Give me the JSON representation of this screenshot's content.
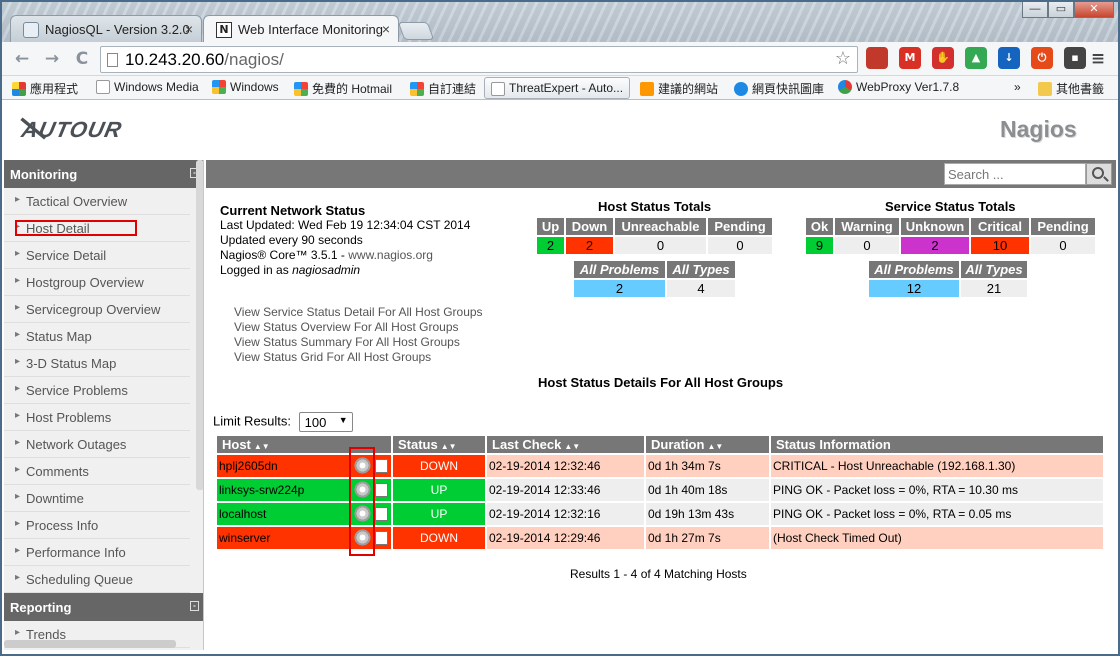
{
  "browser": {
    "tabs": [
      {
        "label": "NagiosQL - Version 3.2.0",
        "icon": "nagiosql-icon",
        "active": false
      },
      {
        "label": "Web Interface Monitoring",
        "icon": "n-icon",
        "icon_glyph": "N",
        "active": true
      }
    ],
    "tab_close": "×",
    "window_buttons": {
      "minimize": "—",
      "maximize": "▭",
      "close": "✕"
    },
    "url_host": "10.243.20.60",
    "url_path": "/nagios/",
    "nav": {
      "back": "←",
      "forward": "→",
      "reload": "C"
    },
    "bookmarks": [
      "應用程式",
      "Windows Media",
      "Windows",
      "免費的 Hotmail",
      "自訂連結",
      "ThreatExpert - Auto...",
      "建議的網站",
      "網頁快訊圖庫",
      "WebProxy Ver1.7.8",
      "»",
      "其他書籤"
    ],
    "extensions": [
      {
        "name": "bookmark-ext-icon",
        "color": "#c0392b",
        "glyph": ""
      },
      {
        "name": "gmail-ext-icon",
        "color": "#d93025",
        "glyph": "M"
      },
      {
        "name": "adblock-ext-icon",
        "color": "#d32f2f",
        "glyph": "✋"
      },
      {
        "name": "drive-ext-icon",
        "color": "#34a853",
        "glyph": "▲"
      },
      {
        "name": "download-ext-icon",
        "color": "#1565c0",
        "glyph": "↓"
      },
      {
        "name": "power-ext-icon",
        "color": "#e64a19",
        "glyph": "⏻"
      },
      {
        "name": "gamepad-ext-icon",
        "color": "#444444",
        "glyph": "▪"
      }
    ],
    "menu_glyph": "≡",
    "star_glyph": "☆"
  },
  "header": {
    "left_logo": "AUTOUR",
    "right_logo": "Nagios"
  },
  "menu": {
    "monitoring_title": "Monitoring",
    "collapse_glyph": "-",
    "monitoring_items": [
      "Tactical Overview",
      "Host Detail",
      "Service Detail",
      "Hostgroup Overview",
      "Servicegroup Overview",
      "Status Map",
      "3-D Status Map",
      "Service Problems",
      "Host Problems",
      "Network Outages",
      "Comments",
      "Downtime",
      "Process Info",
      "Performance Info",
      "Scheduling Queue"
    ],
    "reporting_title": "Reporting",
    "reporting_items": [
      "Trends"
    ]
  },
  "search": {
    "placeholder": "Search ..."
  },
  "status": {
    "title": "Current Network Status",
    "last_updated": "Last Updated: Wed Feb 19 12:34:04 CST 2014",
    "update_interval": "Updated every 90 seconds",
    "core_version": "Nagios® Core™ 3.5.1 - ",
    "core_link": "www.nagios.org",
    "logged_in_prefix": "Logged in as ",
    "user": "nagiosadmin"
  },
  "host_totals": {
    "title": "Host Status Totals",
    "headers": [
      "Up",
      "Down",
      "Unreachable",
      "Pending"
    ],
    "values": [
      "2",
      "2",
      "0",
      "0"
    ],
    "problem_headers": [
      "All Problems",
      "All Types"
    ],
    "problem_values": [
      "2",
      "4"
    ]
  },
  "service_totals": {
    "title": "Service Status Totals",
    "headers": [
      "Ok",
      "Warning",
      "Unknown",
      "Critical",
      "Pending"
    ],
    "values": [
      "9",
      "0",
      "2",
      "10",
      "0"
    ],
    "problem_headers": [
      "All Problems",
      "All Types"
    ],
    "problem_values": [
      "12",
      "21"
    ]
  },
  "view_links": [
    "View Service Status Detail For All Host Groups",
    "View Status Overview For All Host Groups",
    "View Status Summary For All Host Groups",
    "View Status Grid For All Host Groups"
  ],
  "details": {
    "title": "Host Status Details For All Host Groups",
    "limit_label": "Limit Results:",
    "limit_value": "100",
    "sort_glyph": "▲▼",
    "columns": [
      "Host",
      "Status",
      "Last Check",
      "Duration",
      "Status Information"
    ],
    "rows": [
      {
        "host": "hplj2605dn",
        "status": "DOWN",
        "last_check": "02-19-2014 12:32:46",
        "duration": "0d 1h 34m 7s",
        "info": "CRITICAL - Host Unreachable (192.168.1.30)"
      },
      {
        "host": "linksys-srw224p",
        "status": "UP",
        "last_check": "02-19-2014 12:33:46",
        "duration": "0d 1h 40m 18s",
        "info": "PING OK - Packet loss = 0%, RTA = 10.30 ms"
      },
      {
        "host": "localhost",
        "status": "UP",
        "last_check": "02-19-2014 12:32:16",
        "duration": "0d 19h 13m 43s",
        "info": "PING OK - Packet loss = 0%, RTA = 0.05 ms"
      },
      {
        "host": "winserver",
        "status": "DOWN",
        "last_check": "02-19-2014 12:29:46",
        "duration": "0d 1h 27m 7s",
        "info": "(Host Check Timed Out)"
      }
    ],
    "results": "Results 1 - 4 of 4 Matching Hosts"
  },
  "colors": {
    "up": "#00cc33",
    "down": "#ff3300",
    "down_row": "#ffd0c0",
    "unknown": "#cc33cc",
    "critical": "#ff3300",
    "problems": "#66ccff",
    "header_bg": "#777777",
    "annotation": "#e00000"
  }
}
